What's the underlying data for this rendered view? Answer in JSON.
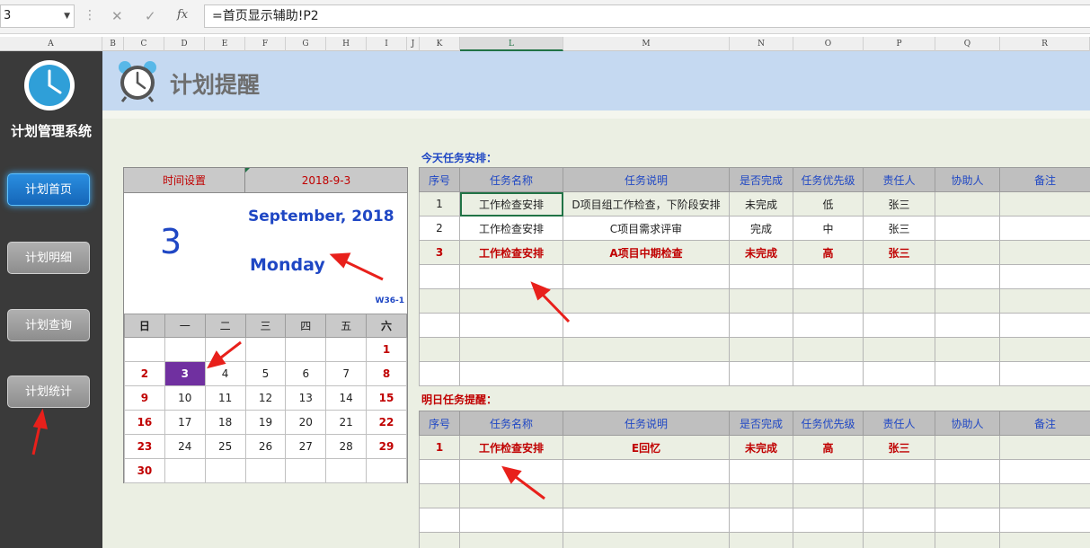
{
  "formula_bar": {
    "name_box": "3",
    "cancel_icon": "✕",
    "confirm_icon": "✓",
    "function_icon": "fx",
    "formula": "=首页显示辅助!P2"
  },
  "columns": [
    "A",
    "B",
    "C",
    "D",
    "E",
    "F",
    "G",
    "H",
    "I",
    "J",
    "K",
    "L",
    "M",
    "N",
    "O",
    "P",
    "Q",
    "R"
  ],
  "nav": {
    "system_title": "计划管理系统",
    "items": [
      {
        "label": "计划首页",
        "active": true
      },
      {
        "label": "计划明细",
        "active": false
      },
      {
        "label": "计划查询",
        "active": false
      },
      {
        "label": "计划统计",
        "active": false
      }
    ]
  },
  "banner": {
    "title": "计划提醒"
  },
  "calendar": {
    "settings_label": "时间设置",
    "settings_date": "2018-9-3",
    "big_day": "3",
    "month_year": "September, 2018",
    "weekday": "Monday",
    "week_code": "W36-1",
    "dow_headers": [
      "日",
      "一",
      "二",
      "三",
      "四",
      "五",
      "六"
    ],
    "weeks": [
      [
        "",
        "",
        "",
        "",
        "",
        "",
        "1"
      ],
      [
        "2",
        "3",
        "4",
        "5",
        "6",
        "7",
        "8"
      ],
      [
        "9",
        "10",
        "11",
        "12",
        "13",
        "14",
        "15"
      ],
      [
        "16",
        "17",
        "18",
        "19",
        "20",
        "21",
        "22"
      ],
      [
        "23",
        "24",
        "25",
        "26",
        "27",
        "28",
        "29"
      ],
      [
        "30",
        "",
        "",
        "",
        "",
        "",
        ""
      ]
    ],
    "today": "3"
  },
  "today_tasks": {
    "label": "今天任务安排：",
    "headers": [
      "序号",
      "任务名称",
      "任务说明",
      "是否完成",
      "任务优先级",
      "责任人",
      "协助人",
      "备注"
    ],
    "rows": [
      [
        "1",
        "工作检查安排",
        "D项目组工作检查，下阶段安排",
        "未完成",
        "低",
        "张三",
        "",
        ""
      ],
      [
        "2",
        "工作检查安排",
        "C项目需求评审",
        "完成",
        "中",
        "张三",
        "",
        ""
      ],
      [
        "3",
        "工作检查安排",
        "A项目中期检查",
        "未完成",
        "高",
        "张三",
        "",
        ""
      ],
      [
        "",
        "",
        "",
        "",
        "",
        "",
        "",
        ""
      ],
      [
        "",
        "",
        "",
        "",
        "",
        "",
        "",
        ""
      ],
      [
        "",
        "",
        "",
        "",
        "",
        "",
        "",
        ""
      ],
      [
        "",
        "",
        "",
        "",
        "",
        "",
        "",
        ""
      ],
      [
        "",
        "",
        "",
        "",
        "",
        "",
        "",
        ""
      ]
    ],
    "urgent_rows": [
      2
    ]
  },
  "tomorrow_tasks": {
    "label": "明日任务提醒：",
    "headers": [
      "序号",
      "任务名称",
      "任务说明",
      "是否完成",
      "任务优先级",
      "责任人",
      "协助人",
      "备注"
    ],
    "rows": [
      [
        "1",
        "工作检查安排",
        "E回忆",
        "未完成",
        "高",
        "张三",
        "",
        ""
      ],
      [
        "",
        "",
        "",
        "",
        "",
        "",
        "",
        ""
      ],
      [
        "",
        "",
        "",
        "",
        "",
        "",
        "",
        ""
      ],
      [
        "",
        "",
        "",
        "",
        "",
        "",
        "",
        ""
      ],
      [
        "",
        "",
        "",
        "",
        "",
        "",
        "",
        ""
      ]
    ],
    "urgent_rows": [
      0
    ]
  },
  "colors": {
    "accent_blue": "#1f47c4",
    "alert_red": "#c00000",
    "today_purple": "#7030a0",
    "banner_blue": "#c5d9f1",
    "arrow_red": "#e8201b"
  }
}
